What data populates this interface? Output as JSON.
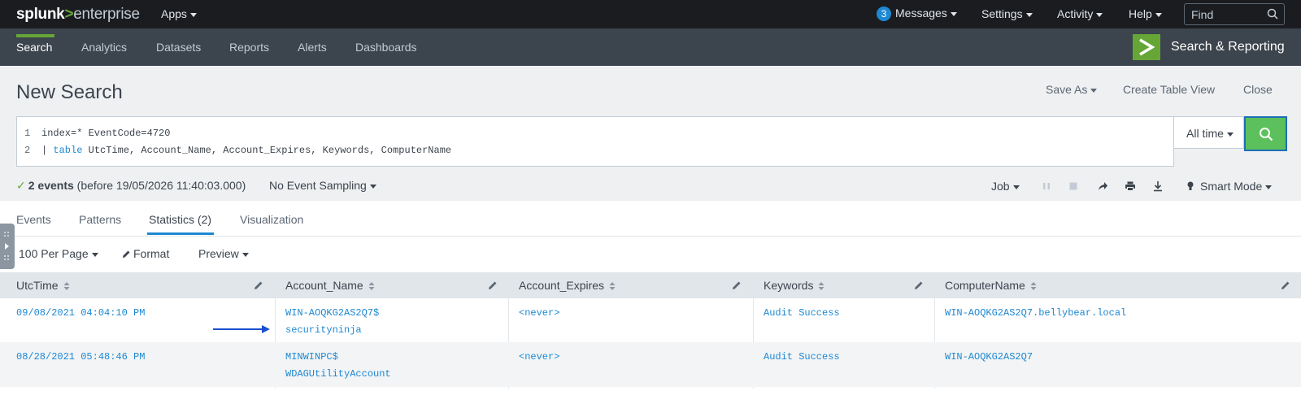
{
  "topbar": {
    "brand_1": "splunk",
    "brand_2": ">",
    "brand_3": "enterprise",
    "apps": "Apps",
    "messages_count": "3",
    "messages": "Messages",
    "settings": "Settings",
    "activity": "Activity",
    "help": "Help",
    "find_placeholder": "Find"
  },
  "appbar": {
    "nav": [
      "Search",
      "Analytics",
      "Datasets",
      "Reports",
      "Alerts",
      "Dashboards"
    ],
    "app_title": "Search & Reporting"
  },
  "header": {
    "title": "New Search",
    "save_as": "Save As",
    "create_table_view": "Create Table View",
    "close": "Close"
  },
  "search": {
    "line1_no": "1",
    "line1": "index=* EventCode=4720",
    "line2_no": "2",
    "line2_pipe": "| ",
    "line2_cmd": "table",
    "line2_rest": " UtcTime, Account_Name, Account_Expires, Keywords, ComputerName",
    "time_range": "All time"
  },
  "status": {
    "check": "✓",
    "count": "2 events",
    "detail": " (before 19/05/2026 11:40:03.000)",
    "sampling": "No Event Sampling",
    "job": "Job",
    "mode": "Smart Mode"
  },
  "tabs": [
    "Events",
    "Patterns",
    "Statistics (2)",
    "Visualization"
  ],
  "table_toolbar": {
    "per_page": "100 Per Page",
    "format": "Format",
    "preview": "Preview"
  },
  "table": {
    "columns": [
      "UtcTime",
      "Account_Name",
      "Account_Expires",
      "Keywords",
      "ComputerName"
    ],
    "rows": [
      {
        "utc": "09/08/2021 04:04:10 PM",
        "account_1": "WIN-AOQKG2AS2Q7$",
        "account_2": "securityninja",
        "expires": "<never>",
        "keywords": "Audit Success",
        "computer": "WIN-AOQKG2AS2Q7.bellybear.local"
      },
      {
        "utc": "08/28/2021 05:48:46 PM",
        "account_1": "MINWINPC$",
        "account_2": "WDAGUtilityAccount",
        "expires": "<never>",
        "keywords": "Audit Success",
        "computer": "WIN-AOQKG2AS2Q7"
      }
    ]
  },
  "colors": {
    "accent_green": "#65a637",
    "link_blue": "#1e88d2",
    "topbar": "#1a1c20",
    "appbar": "#3c444d"
  }
}
